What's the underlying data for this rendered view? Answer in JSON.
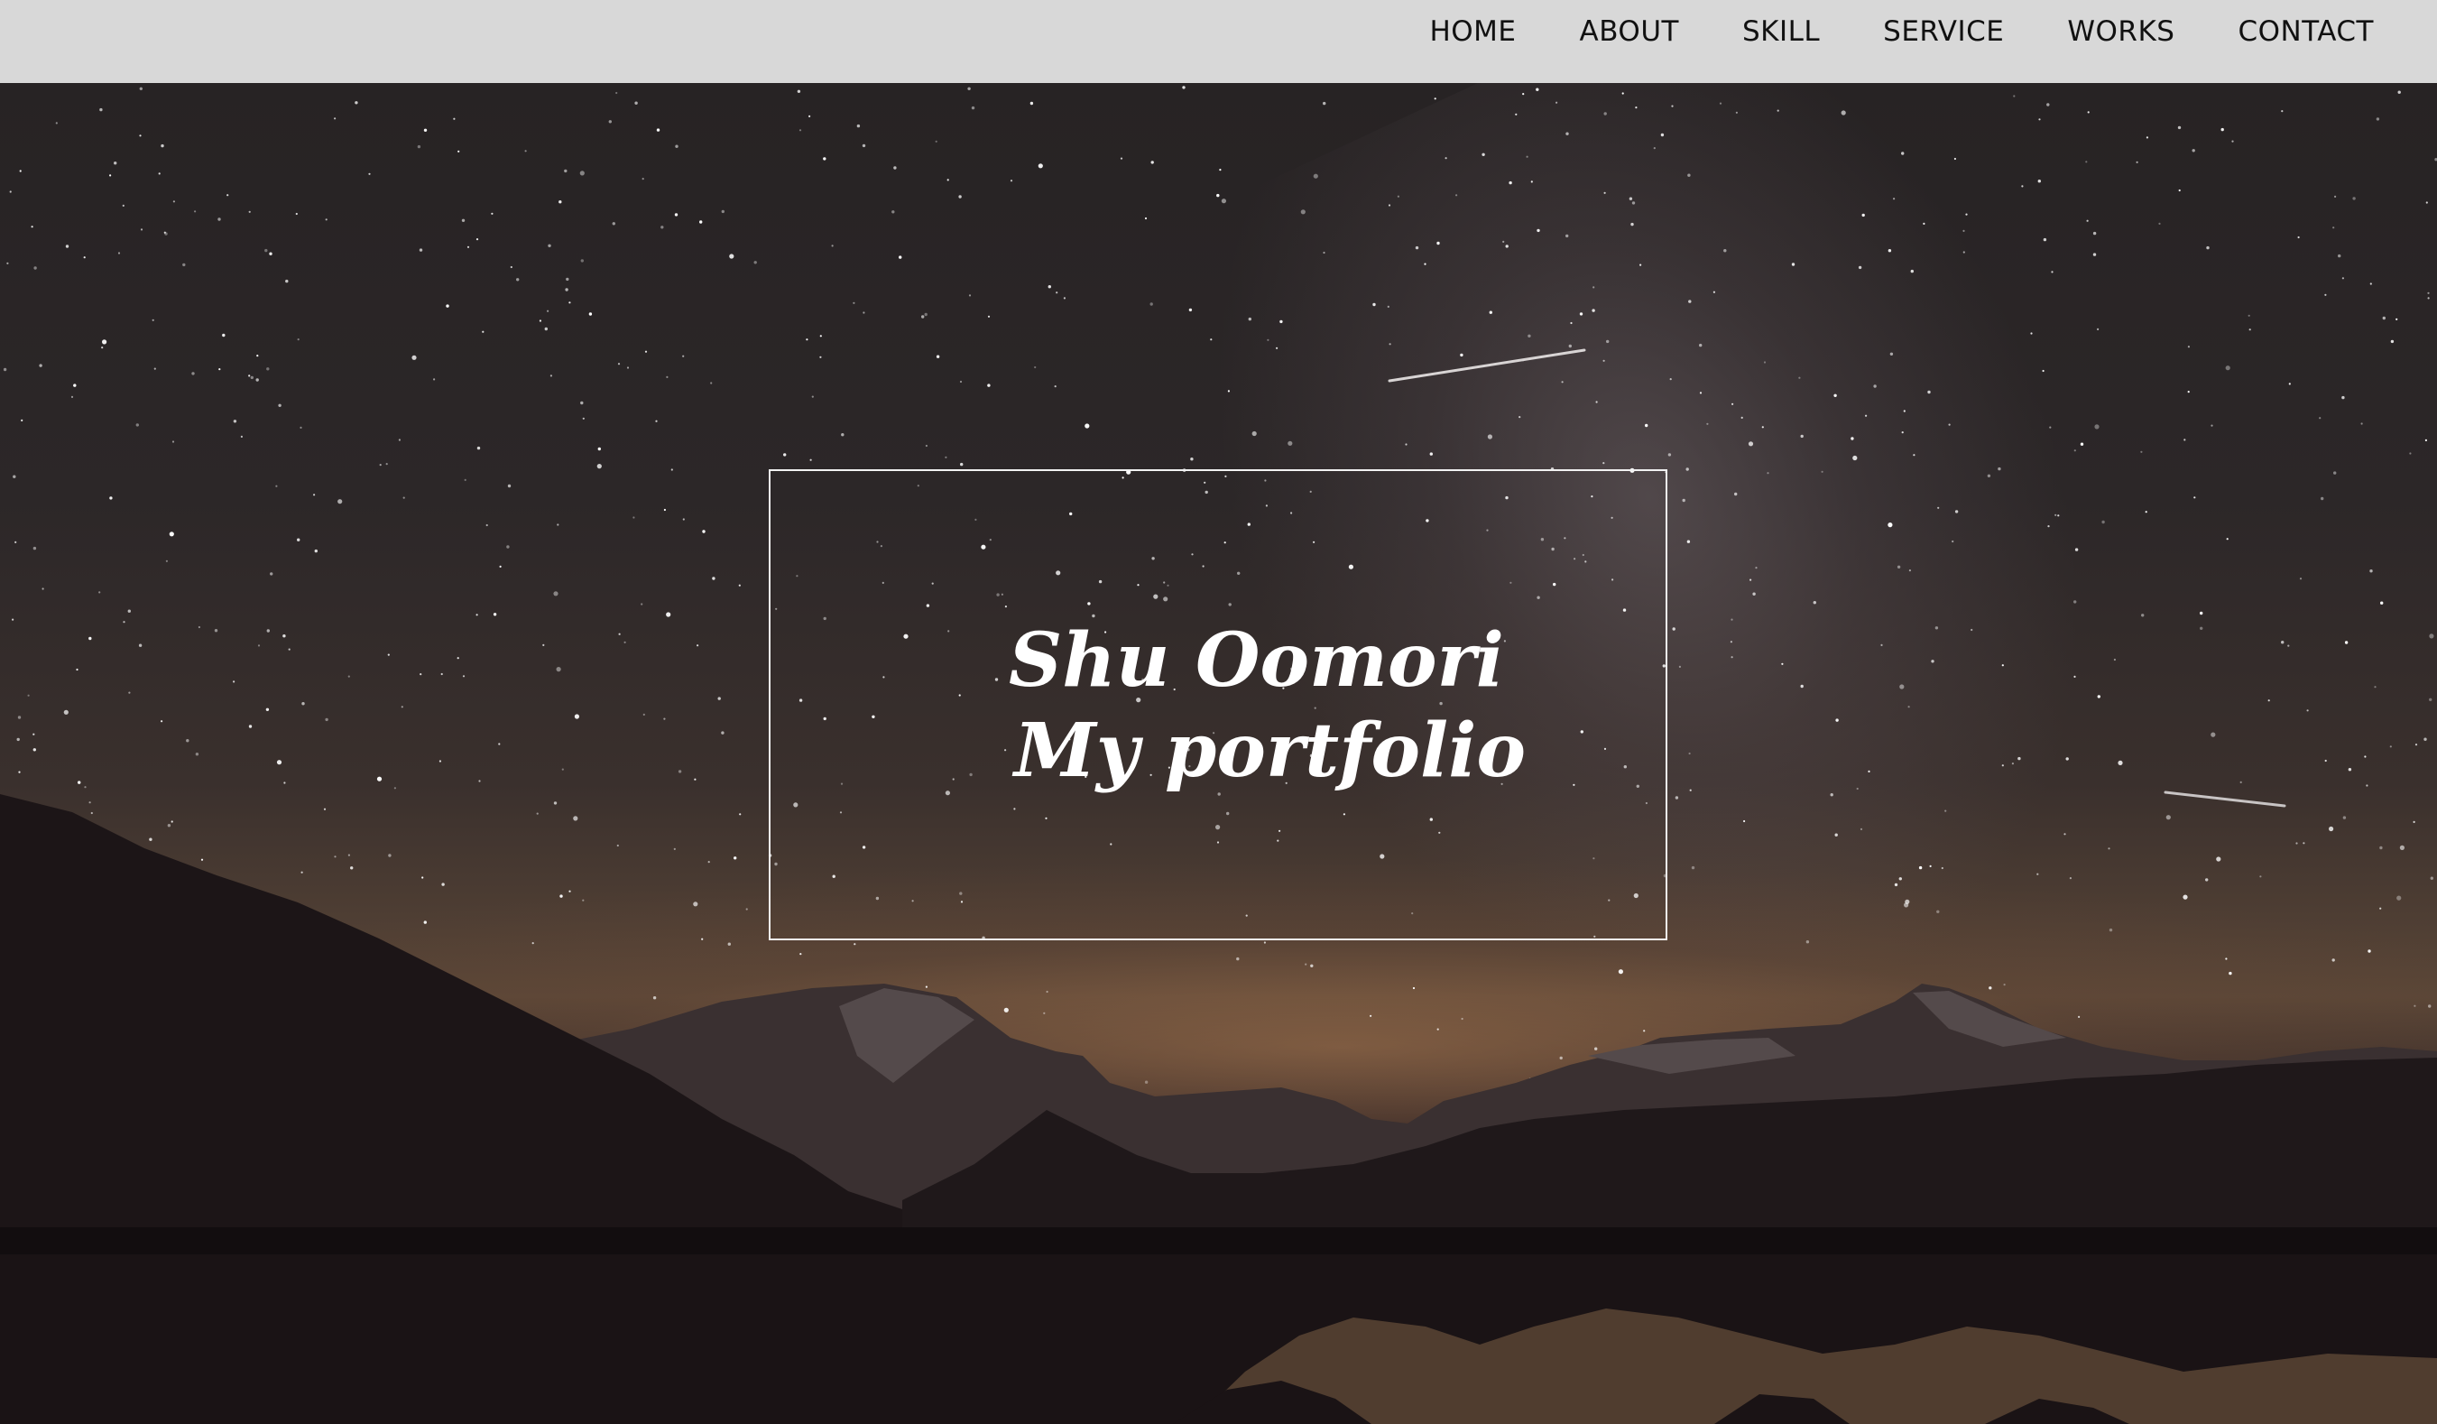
{
  "nav": {
    "items": [
      {
        "label": "HOME"
      },
      {
        "label": "ABOUT"
      },
      {
        "label": "SKILL"
      },
      {
        "label": "SERVICE"
      },
      {
        "label": "WORKS"
      },
      {
        "label": "CONTACT"
      }
    ]
  },
  "hero": {
    "line1": "Shu Oomori",
    "line2": "My portfolio",
    "background_image": "starry-night-sky-mountains-lake"
  },
  "colors": {
    "navbar_bg": "#dedede",
    "nav_text": "#111111",
    "hero_text": "#ffffff",
    "hero_border": "#f2f2f2"
  }
}
